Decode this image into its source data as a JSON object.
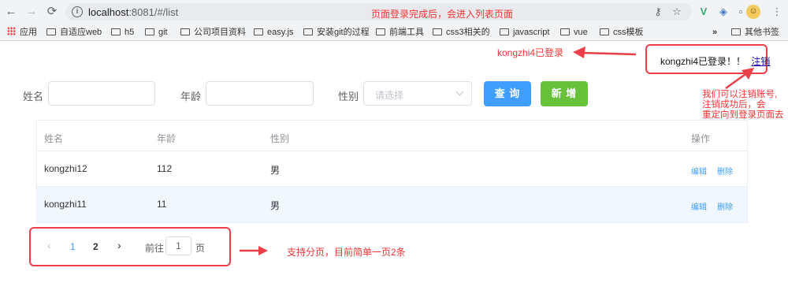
{
  "browser": {
    "url_host": "localhost",
    "url_rest": ":8081/#/list",
    "back_icon": "arrow-left-icon",
    "forward_icon": "arrow-right-icon",
    "reload_icon": "reload-icon"
  },
  "bookmarks": {
    "apps_label": "应用",
    "items": [
      "自适应web",
      "h5",
      "git",
      "公司项目资料",
      "easy.js",
      "安装git的过程",
      "前端工具",
      "css3相关的",
      "javascript",
      "vue",
      "css模板"
    ],
    "more": "»",
    "other_label": "其他书签"
  },
  "annotations": {
    "top": "页面登录完成后，会进入列表页面",
    "login_status": "kongzhi4已登录",
    "logout_note_line1": "我们可以注销账号,",
    "logout_note_line2": "注销成功后，会",
    "logout_note_line3": "重定向到登录页面去",
    "pagination_note": "支持分页，目前简单一页2条"
  },
  "user_bar": {
    "logged_in_text": "kongzhi4已登录！！",
    "logout_link": "注销"
  },
  "search_form": {
    "name_label": "姓名",
    "age_label": "年龄",
    "gender_label": "性别",
    "gender_placeholder": "请选择",
    "query_button": "查 询",
    "add_button": "新 增"
  },
  "table": {
    "headers": [
      "姓名",
      "年龄",
      "性别",
      "操作"
    ],
    "rows": [
      {
        "name": "kongzhi12",
        "age": "112",
        "gender": "男",
        "edit": "编辑",
        "delete": "删除"
      },
      {
        "name": "kongzhi11",
        "age": "11",
        "gender": "男",
        "edit": "编辑",
        "delete": "删除"
      }
    ]
  },
  "pagination": {
    "prev": "‹",
    "pages": [
      "1",
      "2"
    ],
    "current_page": "1",
    "next": "›",
    "goto_prefix": "前往",
    "goto_value": "1",
    "goto_suffix": "页"
  },
  "colors": {
    "annotation_red": "#f03535",
    "primary_blue": "#409eff",
    "success_green": "#67c23a",
    "highlight_row": "#f0f7ff"
  }
}
